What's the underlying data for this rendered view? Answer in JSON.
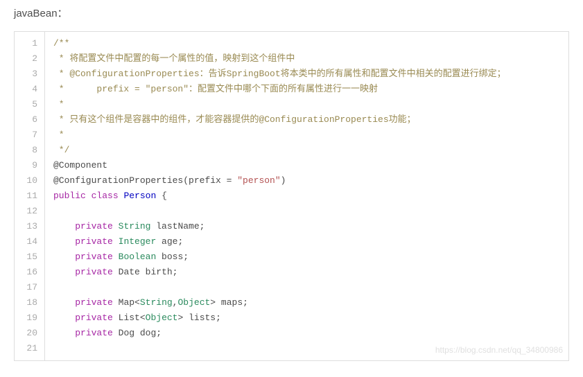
{
  "intro": "javaBean：",
  "watermark": "https://blog.csdn.net/qq_34800986",
  "code": {
    "lines": [
      {
        "n": 1,
        "tokens": [
          {
            "cls": "tok-comment",
            "t": "/**"
          }
        ]
      },
      {
        "n": 2,
        "tokens": [
          {
            "cls": "tok-comment",
            "t": " * 将配置文件中配置的每一个属性的值，映射到这个组件中"
          }
        ]
      },
      {
        "n": 3,
        "tokens": [
          {
            "cls": "tok-comment",
            "t": " * @ConfigurationProperties：告诉SpringBoot将本类中的所有属性和配置文件中相关的配置进行绑定；"
          }
        ]
      },
      {
        "n": 4,
        "tokens": [
          {
            "cls": "tok-comment",
            "t": " *      prefix = \"person\"：配置文件中哪个下面的所有属性进行一一映射"
          }
        ]
      },
      {
        "n": 5,
        "tokens": [
          {
            "cls": "tok-comment",
            "t": " *"
          }
        ]
      },
      {
        "n": 6,
        "tokens": [
          {
            "cls": "tok-comment",
            "t": " * 只有这个组件是容器中的组件，才能容器提供的@ConfigurationProperties功能；"
          }
        ]
      },
      {
        "n": 7,
        "tokens": [
          {
            "cls": "tok-comment",
            "t": " *"
          }
        ]
      },
      {
        "n": 8,
        "tokens": [
          {
            "cls": "tok-comment",
            "t": " */"
          }
        ]
      },
      {
        "n": 9,
        "tokens": [
          {
            "cls": "tok-annotation",
            "t": "@Component"
          }
        ]
      },
      {
        "n": 10,
        "tokens": [
          {
            "cls": "tok-annotation",
            "t": "@ConfigurationProperties"
          },
          {
            "cls": "tok-punct",
            "t": "(prefix = "
          },
          {
            "cls": "tok-string",
            "t": "\"person\""
          },
          {
            "cls": "tok-punct",
            "t": ")"
          }
        ]
      },
      {
        "n": 11,
        "tokens": [
          {
            "cls": "tok-keyword",
            "t": "public"
          },
          {
            "cls": "",
            "t": " "
          },
          {
            "cls": "tok-keyword",
            "t": "class"
          },
          {
            "cls": "",
            "t": " "
          },
          {
            "cls": "tok-keyword2",
            "t": "Person"
          },
          {
            "cls": "tok-punct",
            "t": " {"
          }
        ]
      },
      {
        "n": 12,
        "tokens": [
          {
            "cls": "",
            "t": ""
          }
        ]
      },
      {
        "n": 13,
        "tokens": [
          {
            "cls": "",
            "t": "    "
          },
          {
            "cls": "tok-keyword",
            "t": "private"
          },
          {
            "cls": "",
            "t": " "
          },
          {
            "cls": "tok-type",
            "t": "String"
          },
          {
            "cls": "",
            "t": " lastName;"
          }
        ]
      },
      {
        "n": 14,
        "tokens": [
          {
            "cls": "",
            "t": "    "
          },
          {
            "cls": "tok-keyword",
            "t": "private"
          },
          {
            "cls": "",
            "t": " "
          },
          {
            "cls": "tok-type",
            "t": "Integer"
          },
          {
            "cls": "",
            "t": " age;"
          }
        ]
      },
      {
        "n": 15,
        "tokens": [
          {
            "cls": "",
            "t": "    "
          },
          {
            "cls": "tok-keyword",
            "t": "private"
          },
          {
            "cls": "",
            "t": " "
          },
          {
            "cls": "tok-type",
            "t": "Boolean"
          },
          {
            "cls": "",
            "t": " boss;"
          }
        ]
      },
      {
        "n": 16,
        "tokens": [
          {
            "cls": "",
            "t": "    "
          },
          {
            "cls": "tok-keyword",
            "t": "private"
          },
          {
            "cls": "",
            "t": " "
          },
          {
            "cls": "tok-ident",
            "t": "Date"
          },
          {
            "cls": "",
            "t": " birth;"
          }
        ]
      },
      {
        "n": 17,
        "tokens": [
          {
            "cls": "",
            "t": ""
          }
        ]
      },
      {
        "n": 18,
        "tokens": [
          {
            "cls": "",
            "t": "    "
          },
          {
            "cls": "tok-keyword",
            "t": "private"
          },
          {
            "cls": "",
            "t": " "
          },
          {
            "cls": "tok-ident",
            "t": "Map"
          },
          {
            "cls": "tok-punct",
            "t": "<"
          },
          {
            "cls": "tok-type",
            "t": "String"
          },
          {
            "cls": "tok-punct",
            "t": ","
          },
          {
            "cls": "tok-type",
            "t": "Object"
          },
          {
            "cls": "tok-punct",
            "t": ">"
          },
          {
            "cls": "",
            "t": " maps;"
          }
        ]
      },
      {
        "n": 19,
        "tokens": [
          {
            "cls": "",
            "t": "    "
          },
          {
            "cls": "tok-keyword",
            "t": "private"
          },
          {
            "cls": "",
            "t": " "
          },
          {
            "cls": "tok-ident",
            "t": "List"
          },
          {
            "cls": "tok-punct",
            "t": "<"
          },
          {
            "cls": "tok-type",
            "t": "Object"
          },
          {
            "cls": "tok-punct",
            "t": ">"
          },
          {
            "cls": "",
            "t": " lists;"
          }
        ]
      },
      {
        "n": 20,
        "tokens": [
          {
            "cls": "",
            "t": "    "
          },
          {
            "cls": "tok-keyword",
            "t": "private"
          },
          {
            "cls": "",
            "t": " "
          },
          {
            "cls": "tok-ident",
            "t": "Dog"
          },
          {
            "cls": "",
            "t": " dog;"
          }
        ]
      },
      {
        "n": 21,
        "tokens": [
          {
            "cls": "",
            "t": ""
          }
        ]
      }
    ]
  }
}
